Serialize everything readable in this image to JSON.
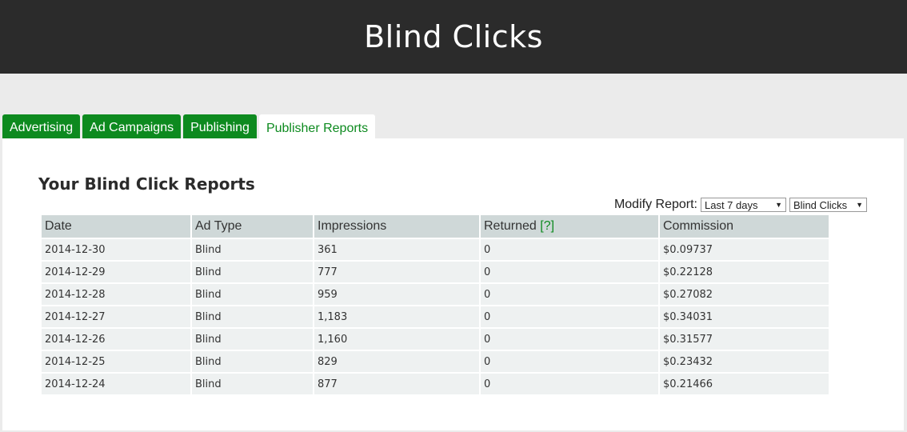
{
  "header": {
    "title": "Blind Clicks"
  },
  "tabs": [
    {
      "label": "Advertising"
    },
    {
      "label": "Ad Campaigns"
    },
    {
      "label": "Publishing"
    },
    {
      "label": "Publisher Reports"
    }
  ],
  "report": {
    "title": "Your Blind Click Reports",
    "modify_label": "Modify Report:",
    "range_select": "Last 7 days",
    "type_select": "Blind Clicks",
    "columns": {
      "date": "Date",
      "ad_type": "Ad Type",
      "impressions": "Impressions",
      "returned": "Returned",
      "returned_help": "[?]",
      "commission": "Commission"
    },
    "rows": [
      {
        "date": "2014-12-30",
        "ad_type": "Blind",
        "impressions": "361",
        "returned": "0",
        "commission": "$0.09737"
      },
      {
        "date": "2014-12-29",
        "ad_type": "Blind",
        "impressions": "777",
        "returned": "0",
        "commission": "$0.22128"
      },
      {
        "date": "2014-12-28",
        "ad_type": "Blind",
        "impressions": "959",
        "returned": "0",
        "commission": "$0.27082"
      },
      {
        "date": "2014-12-27",
        "ad_type": "Blind",
        "impressions": "1,183",
        "returned": "0",
        "commission": "$0.34031"
      },
      {
        "date": "2014-12-26",
        "ad_type": "Blind",
        "impressions": "1,160",
        "returned": "0",
        "commission": "$0.31577"
      },
      {
        "date": "2014-12-25",
        "ad_type": "Blind",
        "impressions": "829",
        "returned": "0",
        "commission": "$0.23432"
      },
      {
        "date": "2014-12-24",
        "ad_type": "Blind",
        "impressions": "877",
        "returned": "0",
        "commission": "$0.21466"
      }
    ]
  },
  "colors": {
    "header_bg": "#2b2b2b",
    "accent": "#0d8a1f"
  }
}
